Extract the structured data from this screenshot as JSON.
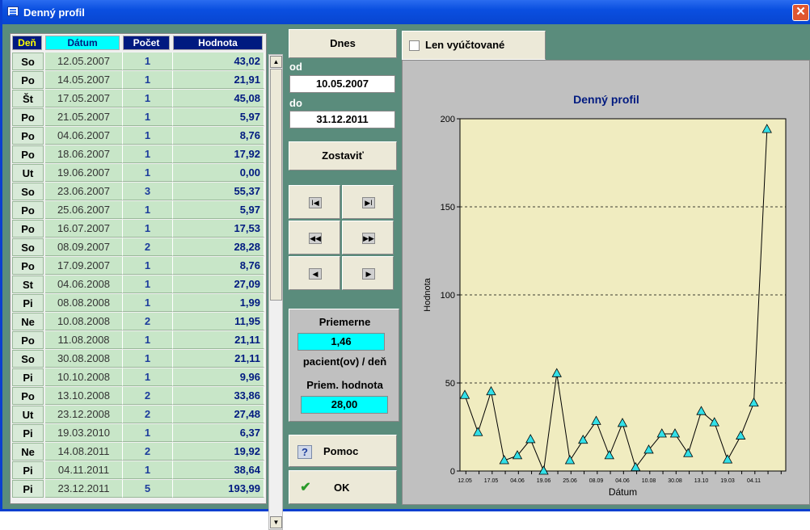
{
  "window": {
    "title": "Denný profil",
    "close": "✕"
  },
  "grid": {
    "headers": {
      "den": "Deň",
      "datum": "Dátum",
      "pocet": "Počet",
      "hodnota": "Hodnota"
    },
    "rows": [
      {
        "den": "So",
        "datum": "12.05.2007",
        "pocet": "1",
        "hodnota": "43,02"
      },
      {
        "den": "Po",
        "datum": "14.05.2007",
        "pocet": "1",
        "hodnota": "21,91"
      },
      {
        "den": "Št",
        "datum": "17.05.2007",
        "pocet": "1",
        "hodnota": "45,08"
      },
      {
        "den": "Po",
        "datum": "21.05.2007",
        "pocet": "1",
        "hodnota": "5,97"
      },
      {
        "den": "Po",
        "datum": "04.06.2007",
        "pocet": "1",
        "hodnota": "8,76"
      },
      {
        "den": "Po",
        "datum": "18.06.2007",
        "pocet": "1",
        "hodnota": "17,92"
      },
      {
        "den": "Ut",
        "datum": "19.06.2007",
        "pocet": "1",
        "hodnota": "0,00"
      },
      {
        "den": "So",
        "datum": "23.06.2007",
        "pocet": "3",
        "hodnota": "55,37"
      },
      {
        "den": "Po",
        "datum": "25.06.2007",
        "pocet": "1",
        "hodnota": "5,97"
      },
      {
        "den": "Po",
        "datum": "16.07.2007",
        "pocet": "1",
        "hodnota": "17,53"
      },
      {
        "den": "So",
        "datum": "08.09.2007",
        "pocet": "2",
        "hodnota": "28,28"
      },
      {
        "den": "Po",
        "datum": "17.09.2007",
        "pocet": "1",
        "hodnota": "8,76"
      },
      {
        "den": "St",
        "datum": "04.06.2008",
        "pocet": "1",
        "hodnota": "27,09"
      },
      {
        "den": "Pi",
        "datum": "08.08.2008",
        "pocet": "1",
        "hodnota": "1,99"
      },
      {
        "den": "Ne",
        "datum": "10.08.2008",
        "pocet": "2",
        "hodnota": "11,95"
      },
      {
        "den": "Po",
        "datum": "11.08.2008",
        "pocet": "1",
        "hodnota": "21,11"
      },
      {
        "den": "So",
        "datum": "30.08.2008",
        "pocet": "1",
        "hodnota": "21,11"
      },
      {
        "den": "Pi",
        "datum": "10.10.2008",
        "pocet": "1",
        "hodnota": "9,96"
      },
      {
        "den": "Po",
        "datum": "13.10.2008",
        "pocet": "2",
        "hodnota": "33,86"
      },
      {
        "den": "Ut",
        "datum": "23.12.2008",
        "pocet": "2",
        "hodnota": "27,48"
      },
      {
        "den": "Pi",
        "datum": "19.03.2010",
        "pocet": "1",
        "hodnota": "6,37"
      },
      {
        "den": "Ne",
        "datum": "14.08.2011",
        "pocet": "2",
        "hodnota": "19,92"
      },
      {
        "den": "Pi",
        "datum": "04.11.2011",
        "pocet": "1",
        "hodnota": "38,64"
      },
      {
        "den": "Pi",
        "datum": "23.12.2011",
        "pocet": "5",
        "hodnota": "193,99"
      }
    ]
  },
  "controls": {
    "dnes": "Dnes",
    "od_label": "od",
    "od_value": "10.05.2007",
    "do_label": "do",
    "do_value": "31.12.2011",
    "zostavit": "Zostaviť",
    "nav": {
      "first": "I◀",
      "last": "▶I",
      "prev_page": "◀◀",
      "next_page": "▶▶",
      "prev": "◀",
      "next": "▶"
    }
  },
  "stats": {
    "priemerne_label": "Priemerne",
    "priemerne_value": "1,46",
    "unit_label": "pacient(ov) / deň",
    "priem_hodnota_label": "Priem. hodnota",
    "priem_hodnota_value": "28,00"
  },
  "buttons": {
    "pomoc": "Pomoc",
    "ok": "OK"
  },
  "filter": {
    "checkbox_label": "Len vyúčtované",
    "checked": false
  },
  "colors": {
    "titlebar": "#0a4fe0",
    "header": "#001a80",
    "accent_cyan": "#00ffff",
    "plot_bg": "#f0ecc0",
    "marker": "#33e0e8",
    "window_bg": "#5a8c7c"
  },
  "chart_data": {
    "type": "line",
    "title": "Denný profil",
    "xlabel": "Dátum",
    "ylabel": "Hodnota",
    "ylim": [
      0,
      200
    ],
    "yticks": [
      "0",
      "50",
      "100",
      "150",
      "200"
    ],
    "grid": "horizontal dashed",
    "x_tick_labels": [
      "12.05",
      "17.05",
      "04.06",
      "19.06",
      "25.06",
      "08.09",
      "04.06",
      "10.08",
      "30.08",
      "13.10",
      "19.03",
      "04.11"
    ],
    "categories": [
      "12.05.2007",
      "14.05.2007",
      "17.05.2007",
      "21.05.2007",
      "04.06.2007",
      "18.06.2007",
      "19.06.2007",
      "23.06.2007",
      "25.06.2007",
      "16.07.2007",
      "08.09.2007",
      "17.09.2007",
      "04.06.2008",
      "08.08.2008",
      "10.08.2008",
      "11.08.2008",
      "30.08.2008",
      "10.10.2008",
      "13.10.2008",
      "23.12.2008",
      "19.03.2010",
      "14.08.2011",
      "04.11.2011",
      "23.12.2011"
    ],
    "values": [
      43.02,
      21.91,
      45.08,
      5.97,
      8.76,
      17.92,
      0.0,
      55.37,
      5.97,
      17.53,
      28.28,
      8.76,
      27.09,
      1.99,
      11.95,
      21.11,
      21.11,
      9.96,
      33.86,
      27.48,
      6.37,
      19.92,
      38.64,
      193.99
    ]
  }
}
